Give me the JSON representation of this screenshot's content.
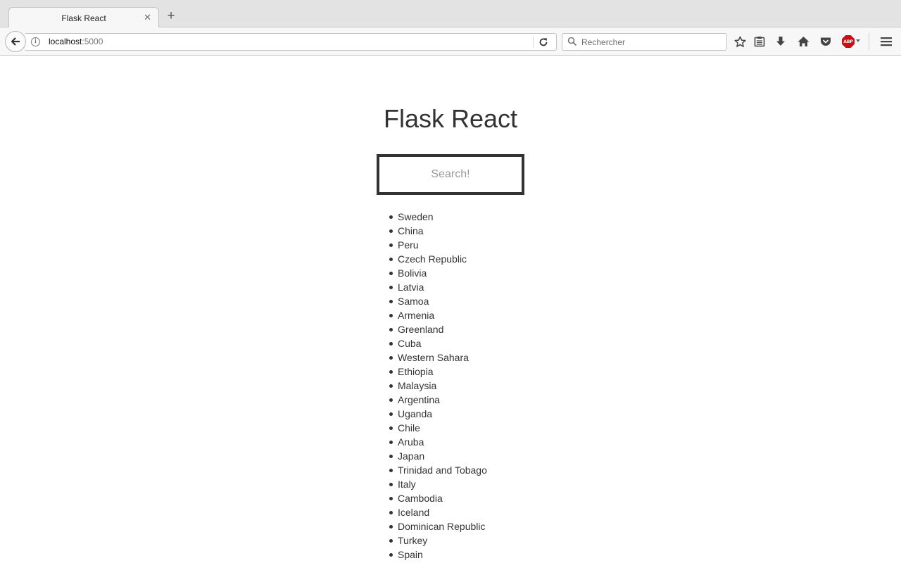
{
  "browser": {
    "tab_title": "Flask React",
    "tab_close": "✕",
    "new_tab": "+",
    "url_host": "localhost",
    "url_port": ":5000",
    "search_placeholder": "Rechercher",
    "abp_label": "ABP"
  },
  "page": {
    "title": "Flask React",
    "search_placeholder": "Search!",
    "countries": [
      "Sweden",
      "China",
      "Peru",
      "Czech Republic",
      "Bolivia",
      "Latvia",
      "Samoa",
      "Armenia",
      "Greenland",
      "Cuba",
      "Western Sahara",
      "Ethiopia",
      "Malaysia",
      "Argentina",
      "Uganda",
      "Chile",
      "Aruba",
      "Japan",
      "Trinidad and Tobago",
      "Italy",
      "Cambodia",
      "Iceland",
      "Dominican Republic",
      "Turkey",
      "Spain"
    ]
  },
  "colors": {
    "text": "#333333",
    "abp_red": "#c8101b",
    "chrome_bg": "#e3e3e3"
  },
  "icons": [
    "back-arrow-icon",
    "info-icon",
    "reload-icon",
    "search-icon",
    "bookmark-star-icon",
    "reading-list-icon",
    "download-icon",
    "home-icon",
    "pocket-icon",
    "adblock-icon",
    "hamburger-menu-icon"
  ]
}
